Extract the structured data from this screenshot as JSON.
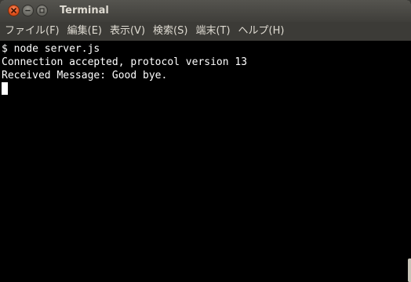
{
  "window": {
    "title": "Terminal"
  },
  "menu": {
    "items": [
      {
        "label": "ファイル(F)"
      },
      {
        "label": "編集(E)"
      },
      {
        "label": "表示(V)"
      },
      {
        "label": "検索(S)"
      },
      {
        "label": "端末(T)"
      },
      {
        "label": "ヘルプ(H)"
      }
    ]
  },
  "terminal": {
    "lines": [
      "$ node server.js",
      "Connection accepted, protocol version 13",
      "Received Message: Good bye."
    ]
  },
  "icons": {
    "close": "close-icon",
    "minimize": "minimize-icon",
    "maximize": "maximize-icon"
  },
  "colors": {
    "background": "#000000",
    "text": "#ffffff",
    "titlebar": "#3c3b37",
    "close_button": "#e0501c"
  }
}
